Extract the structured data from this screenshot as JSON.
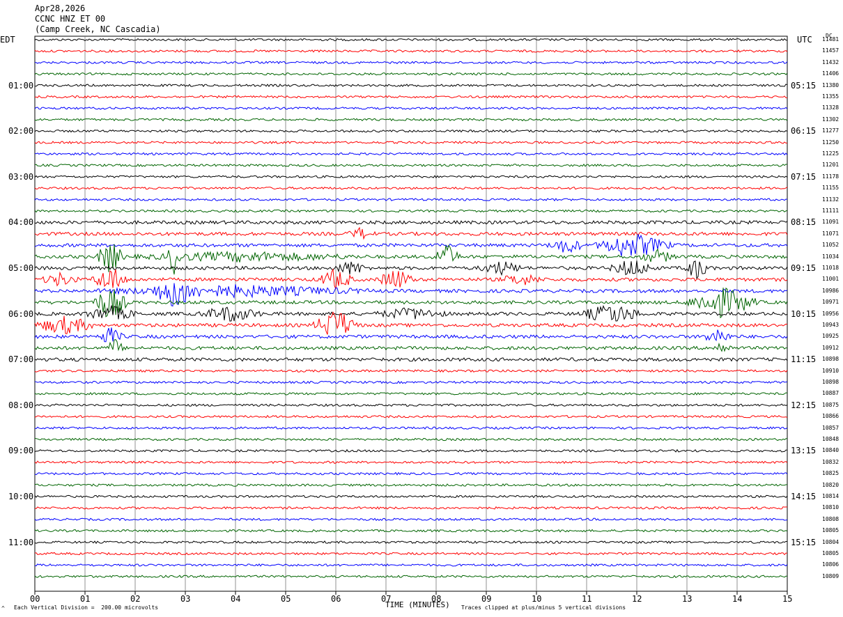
{
  "header": {
    "date": "Apr28,2026",
    "station": "CCNC HNZ ET 00",
    "location": "(Camp Creek, NC Cascadia)"
  },
  "left_tz": "EDT",
  "right_tz": "UTC",
  "dc_label": "DC",
  "footer": {
    "scale_note": "Each Vertical Division =  200.00 microvolts",
    "clip_note": "Traces clipped at plus/minus 5 vertical divisions",
    "corner_mark": "^"
  },
  "chart_data": {
    "type": "line",
    "xlabel": "TIME (MINUTES)",
    "xlim": [
      0,
      15
    ],
    "x_ticks": [
      "00",
      "01",
      "02",
      "03",
      "04",
      "05",
      "06",
      "07",
      "08",
      "09",
      "10",
      "11",
      "12",
      "13",
      "14",
      "15"
    ],
    "trace_colors": [
      "#000000",
      "#ff0000",
      "#0000ff",
      "#006400"
    ],
    "row_count": 48,
    "left_hour_labels": [
      {
        "row": 4,
        "text": "01:00"
      },
      {
        "row": 8,
        "text": "02:00"
      },
      {
        "row": 12,
        "text": "03:00"
      },
      {
        "row": 16,
        "text": "04:00"
      },
      {
        "row": 20,
        "text": "05:00"
      },
      {
        "row": 24,
        "text": "06:00"
      },
      {
        "row": 28,
        "text": "07:00"
      },
      {
        "row": 32,
        "text": "08:00"
      },
      {
        "row": 36,
        "text": "09:00"
      },
      {
        "row": 40,
        "text": "10:00"
      },
      {
        "row": 44,
        "text": "11:00"
      }
    ],
    "right_hour_labels": [
      {
        "row": 4,
        "text": "05:15"
      },
      {
        "row": 8,
        "text": "06:15"
      },
      {
        "row": 12,
        "text": "07:15"
      },
      {
        "row": 16,
        "text": "08:15"
      },
      {
        "row": 20,
        "text": "09:15"
      },
      {
        "row": 24,
        "text": "10:15"
      },
      {
        "row": 28,
        "text": "11:15"
      },
      {
        "row": 32,
        "text": "12:15"
      },
      {
        "row": 36,
        "text": "13:15"
      },
      {
        "row": 40,
        "text": "14:15"
      },
      {
        "row": 44,
        "text": "15:15"
      }
    ],
    "dc_offsets": [
      "11481",
      "11457",
      "11432",
      "11406",
      "11380",
      "11355",
      "11328",
      "11302",
      "11277",
      "11250",
      "11225",
      "11201",
      "11178",
      "11155",
      "11132",
      "11111",
      "11091",
      "11071",
      "11052",
      "11034",
      "11018",
      "11001",
      "10986",
      "10971",
      "10956",
      "10943",
      "10925",
      "10912",
      "10898",
      "10910",
      "10898",
      "10887",
      "10875",
      "10866",
      "10857",
      "10848",
      "10840",
      "10832",
      "10825",
      "10820",
      "10814",
      "10810",
      "10808",
      "10805",
      "10804",
      "10805",
      "10806",
      "10809"
    ],
    "events": [
      {
        "row": 17,
        "minute": 6.5,
        "amp": 0.5,
        "dur": 0.3
      },
      {
        "row": 18,
        "minute": 10.6,
        "amp": 0.7,
        "dur": 0.4
      },
      {
        "row": 18,
        "minute": 11.7,
        "amp": 0.9,
        "dur": 0.6
      },
      {
        "row": 18,
        "minute": 12.2,
        "amp": 0.7,
        "dur": 0.6
      },
      {
        "row": 19,
        "minute": 1.5,
        "amp": 1.6,
        "dur": 0.3
      },
      {
        "row": 19,
        "minute": 2.8,
        "amp": 1.6,
        "dur": 0.2
      },
      {
        "row": 19,
        "minute": 4.2,
        "amp": 0.4,
        "dur": 2.5
      },
      {
        "row": 19,
        "minute": 8.2,
        "amp": 1.2,
        "dur": 0.3
      },
      {
        "row": 19,
        "minute": 12.4,
        "amp": 0.6,
        "dur": 0.4
      },
      {
        "row": 20,
        "minute": 6.3,
        "amp": 0.6,
        "dur": 0.4
      },
      {
        "row": 20,
        "minute": 9.3,
        "amp": 0.6,
        "dur": 0.5
      },
      {
        "row": 20,
        "minute": 11.9,
        "amp": 0.8,
        "dur": 0.5
      },
      {
        "row": 20,
        "minute": 13.2,
        "amp": 1.0,
        "dur": 0.3
      },
      {
        "row": 21,
        "minute": 0.5,
        "amp": 0.6,
        "dur": 0.4
      },
      {
        "row": 21,
        "minute": 1.5,
        "amp": 1.2,
        "dur": 0.4
      },
      {
        "row": 21,
        "minute": 6.0,
        "amp": 1.0,
        "dur": 0.4
      },
      {
        "row": 21,
        "minute": 7.2,
        "amp": 1.0,
        "dur": 0.4
      },
      {
        "row": 21,
        "minute": 9.7,
        "amp": 0.5,
        "dur": 0.5
      },
      {
        "row": 22,
        "minute": 2.8,
        "amp": 1.3,
        "dur": 0.5
      },
      {
        "row": 22,
        "minute": 4.0,
        "amp": 0.5,
        "dur": 3.0
      },
      {
        "row": 23,
        "minute": 1.5,
        "amp": 1.6,
        "dur": 0.4
      },
      {
        "row": 23,
        "minute": 13.7,
        "amp": 1.4,
        "dur": 0.8
      },
      {
        "row": 24,
        "minute": 1.5,
        "amp": 0.7,
        "dur": 0.6
      },
      {
        "row": 24,
        "minute": 3.9,
        "amp": 0.7,
        "dur": 0.7
      },
      {
        "row": 24,
        "minute": 7.5,
        "amp": 0.5,
        "dur": 0.8
      },
      {
        "row": 24,
        "minute": 11.5,
        "amp": 0.9,
        "dur": 0.7
      },
      {
        "row": 25,
        "minute": 0.6,
        "amp": 0.8,
        "dur": 0.7
      },
      {
        "row": 25,
        "minute": 6.0,
        "amp": 1.5,
        "dur": 0.5
      },
      {
        "row": 26,
        "minute": 1.5,
        "amp": 0.8,
        "dur": 0.3
      },
      {
        "row": 26,
        "minute": 13.6,
        "amp": 0.8,
        "dur": 0.3
      },
      {
        "row": 27,
        "minute": 1.6,
        "amp": 0.8,
        "dur": 0.2
      },
      {
        "row": 27,
        "minute": 13.7,
        "amp": 0.6,
        "dur": 0.2
      }
    ]
  }
}
